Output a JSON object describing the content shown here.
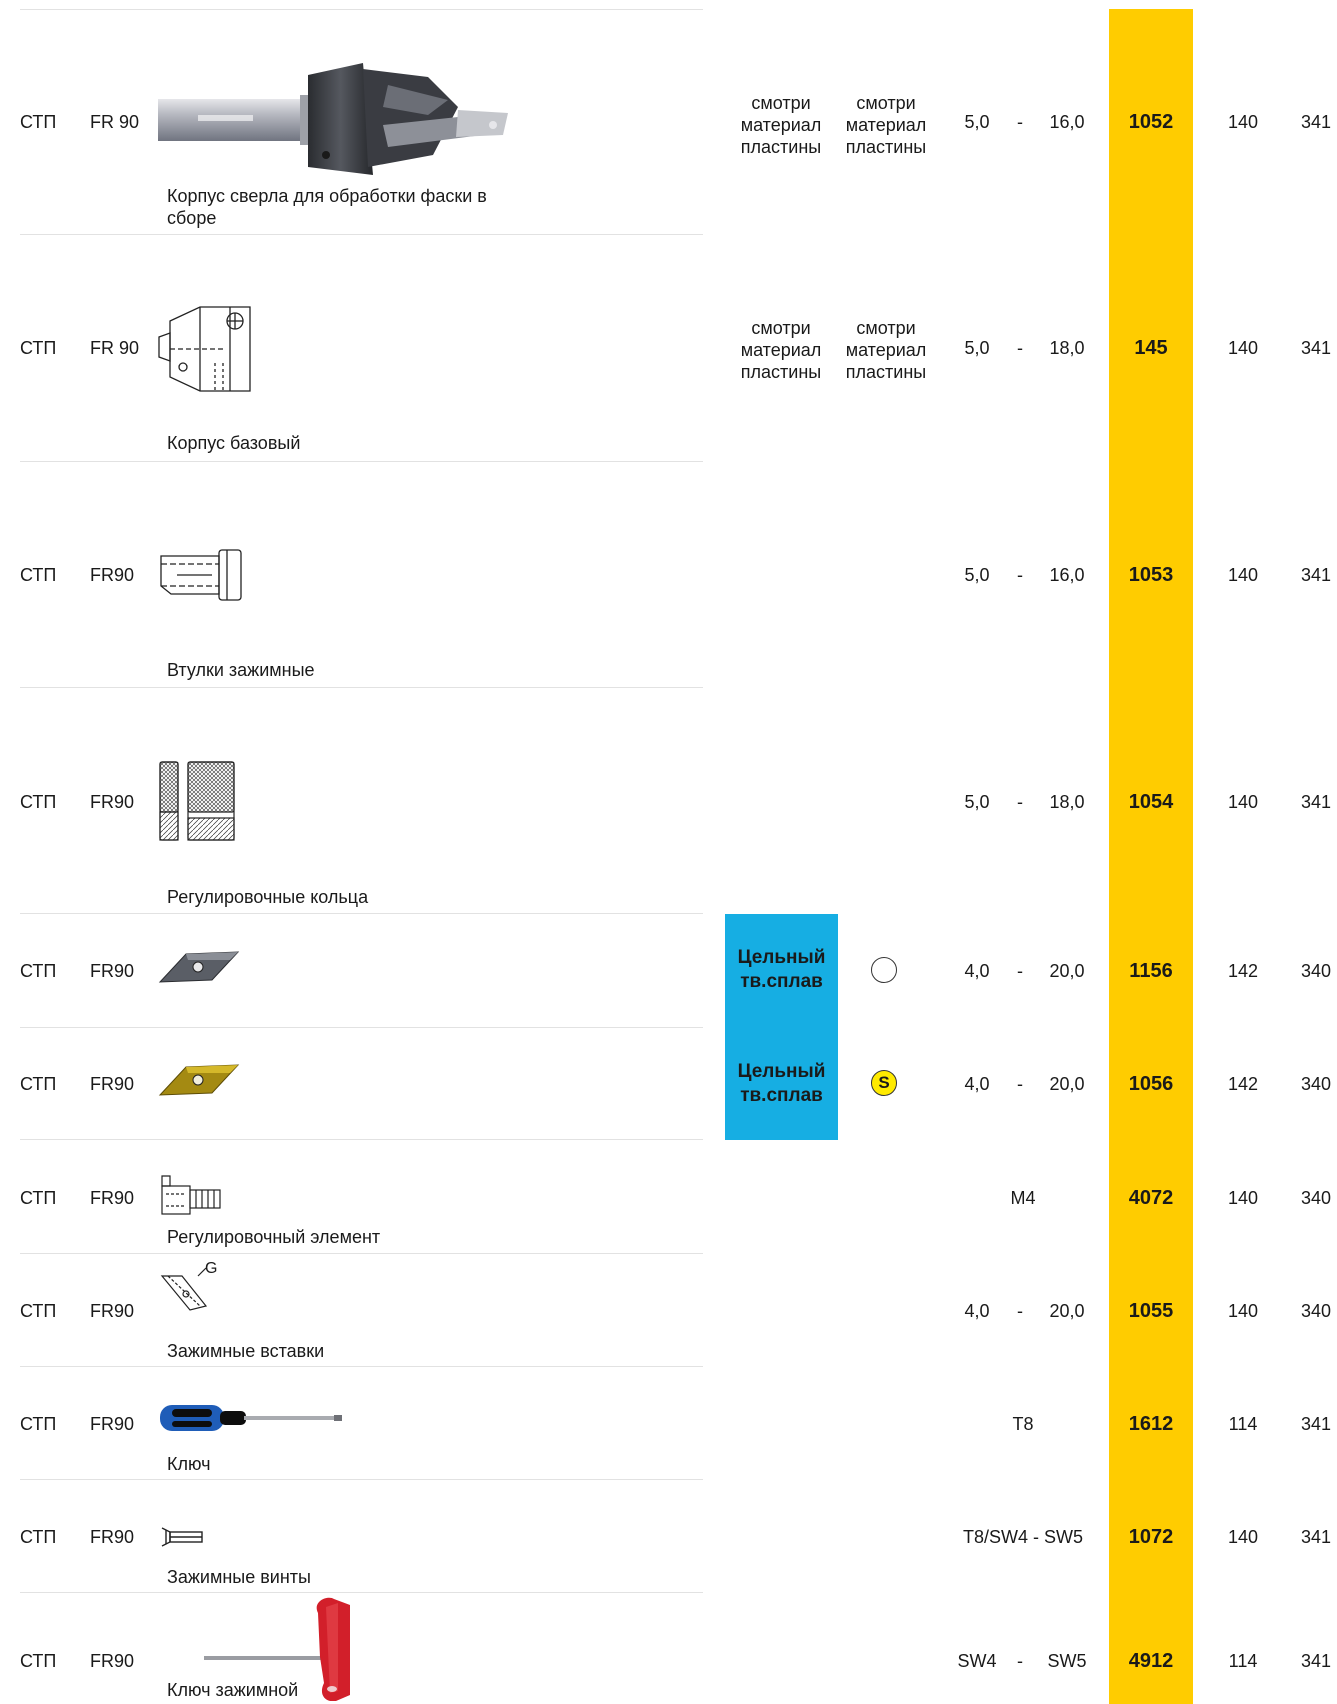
{
  "colors": {
    "price_column": "#ffcc00",
    "material_box": "#16aee3",
    "coating_circle": "#ffea00"
  },
  "rows": [
    {
      "type": "СТП",
      "series": "FR 90",
      "desc": "Корпус сверла для обработки фаски в сборе",
      "mat1": "смотри материал пластины",
      "mat2": "смотри материал пластины",
      "d_from": "5,0",
      "dash": "-",
      "d_to": "16,0",
      "code": "1052",
      "page1": "140",
      "page2": "341",
      "image": "chamfer-drill-assembly-photo"
    },
    {
      "type": "СТП",
      "series": "FR 90",
      "desc": "Корпус базовый",
      "mat1": "смотри материал пластины",
      "mat2": "смотри материал пластины",
      "d_from": "5,0",
      "dash": "-",
      "d_to": "18,0",
      "code": "145",
      "page1": "140",
      "page2": "341",
      "image": "base-body-drawing"
    },
    {
      "type": "СТП",
      "series": "FR90",
      "desc": "Втулки зажимные",
      "d_from": "5,0",
      "dash": "-",
      "d_to": "16,0",
      "code": "1053",
      "page1": "140",
      "page2": "341",
      "image": "clamping-sleeve-drawing"
    },
    {
      "type": "СТП",
      "series": "FR90",
      "desc": "Регулировочные кольца",
      "d_from": "5,0",
      "dash": "-",
      "d_to": "18,0",
      "code": "1054",
      "page1": "140",
      "page2": "341",
      "image": "adjusting-rings-drawing"
    },
    {
      "type": "СТП",
      "series": "FR90",
      "material": "Цельный тв.сплав",
      "coating": "",
      "d_from": "4,0",
      "dash": "-",
      "d_to": "20,0",
      "code": "1156",
      "page1": "142",
      "page2": "340",
      "image": "insert-grey-photo"
    },
    {
      "type": "СТП",
      "series": "FR90",
      "material": "Цельный тв.сплав",
      "coating": "S",
      "d_from": "4,0",
      "dash": "-",
      "d_to": "20,0",
      "code": "1056",
      "page1": "142",
      "page2": "340",
      "image": "insert-gold-photo"
    },
    {
      "type": "СТП",
      "series": "FR90",
      "desc": "Регулировочный элемент",
      "mid": "M4",
      "code": "4072",
      "page1": "140",
      "page2": "340",
      "image": "adjusting-element-drawing"
    },
    {
      "type": "СТП",
      "series": "FR90",
      "desc": "Зажимные вставки",
      "img_label": "G",
      "d_from": "4,0",
      "dash": "-",
      "d_to": "20,0",
      "code": "1055",
      "page1": "140",
      "page2": "340",
      "image": "clamping-insert-drawing"
    },
    {
      "type": "СТП",
      "series": "FR90",
      "desc": "Ключ",
      "mid": "T8",
      "code": "1612",
      "page1": "114",
      "page2": "341",
      "image": "screwdriver-photo"
    },
    {
      "type": "СТП",
      "series": "FR90",
      "desc": "Зажимные винты",
      "mid": "T8/SW4 - SW5",
      "code": "1072",
      "page1": "140",
      "page2": "341",
      "image": "clamping-screw-drawing"
    },
    {
      "type": "СТП",
      "series": "FR90",
      "desc": "Ключ зажимной",
      "d_from": "SW4",
      "dash": "-",
      "d_to": "SW5",
      "code": "4912",
      "page1": "114",
      "page2": "341",
      "image": "t-handle-key-photo"
    }
  ]
}
